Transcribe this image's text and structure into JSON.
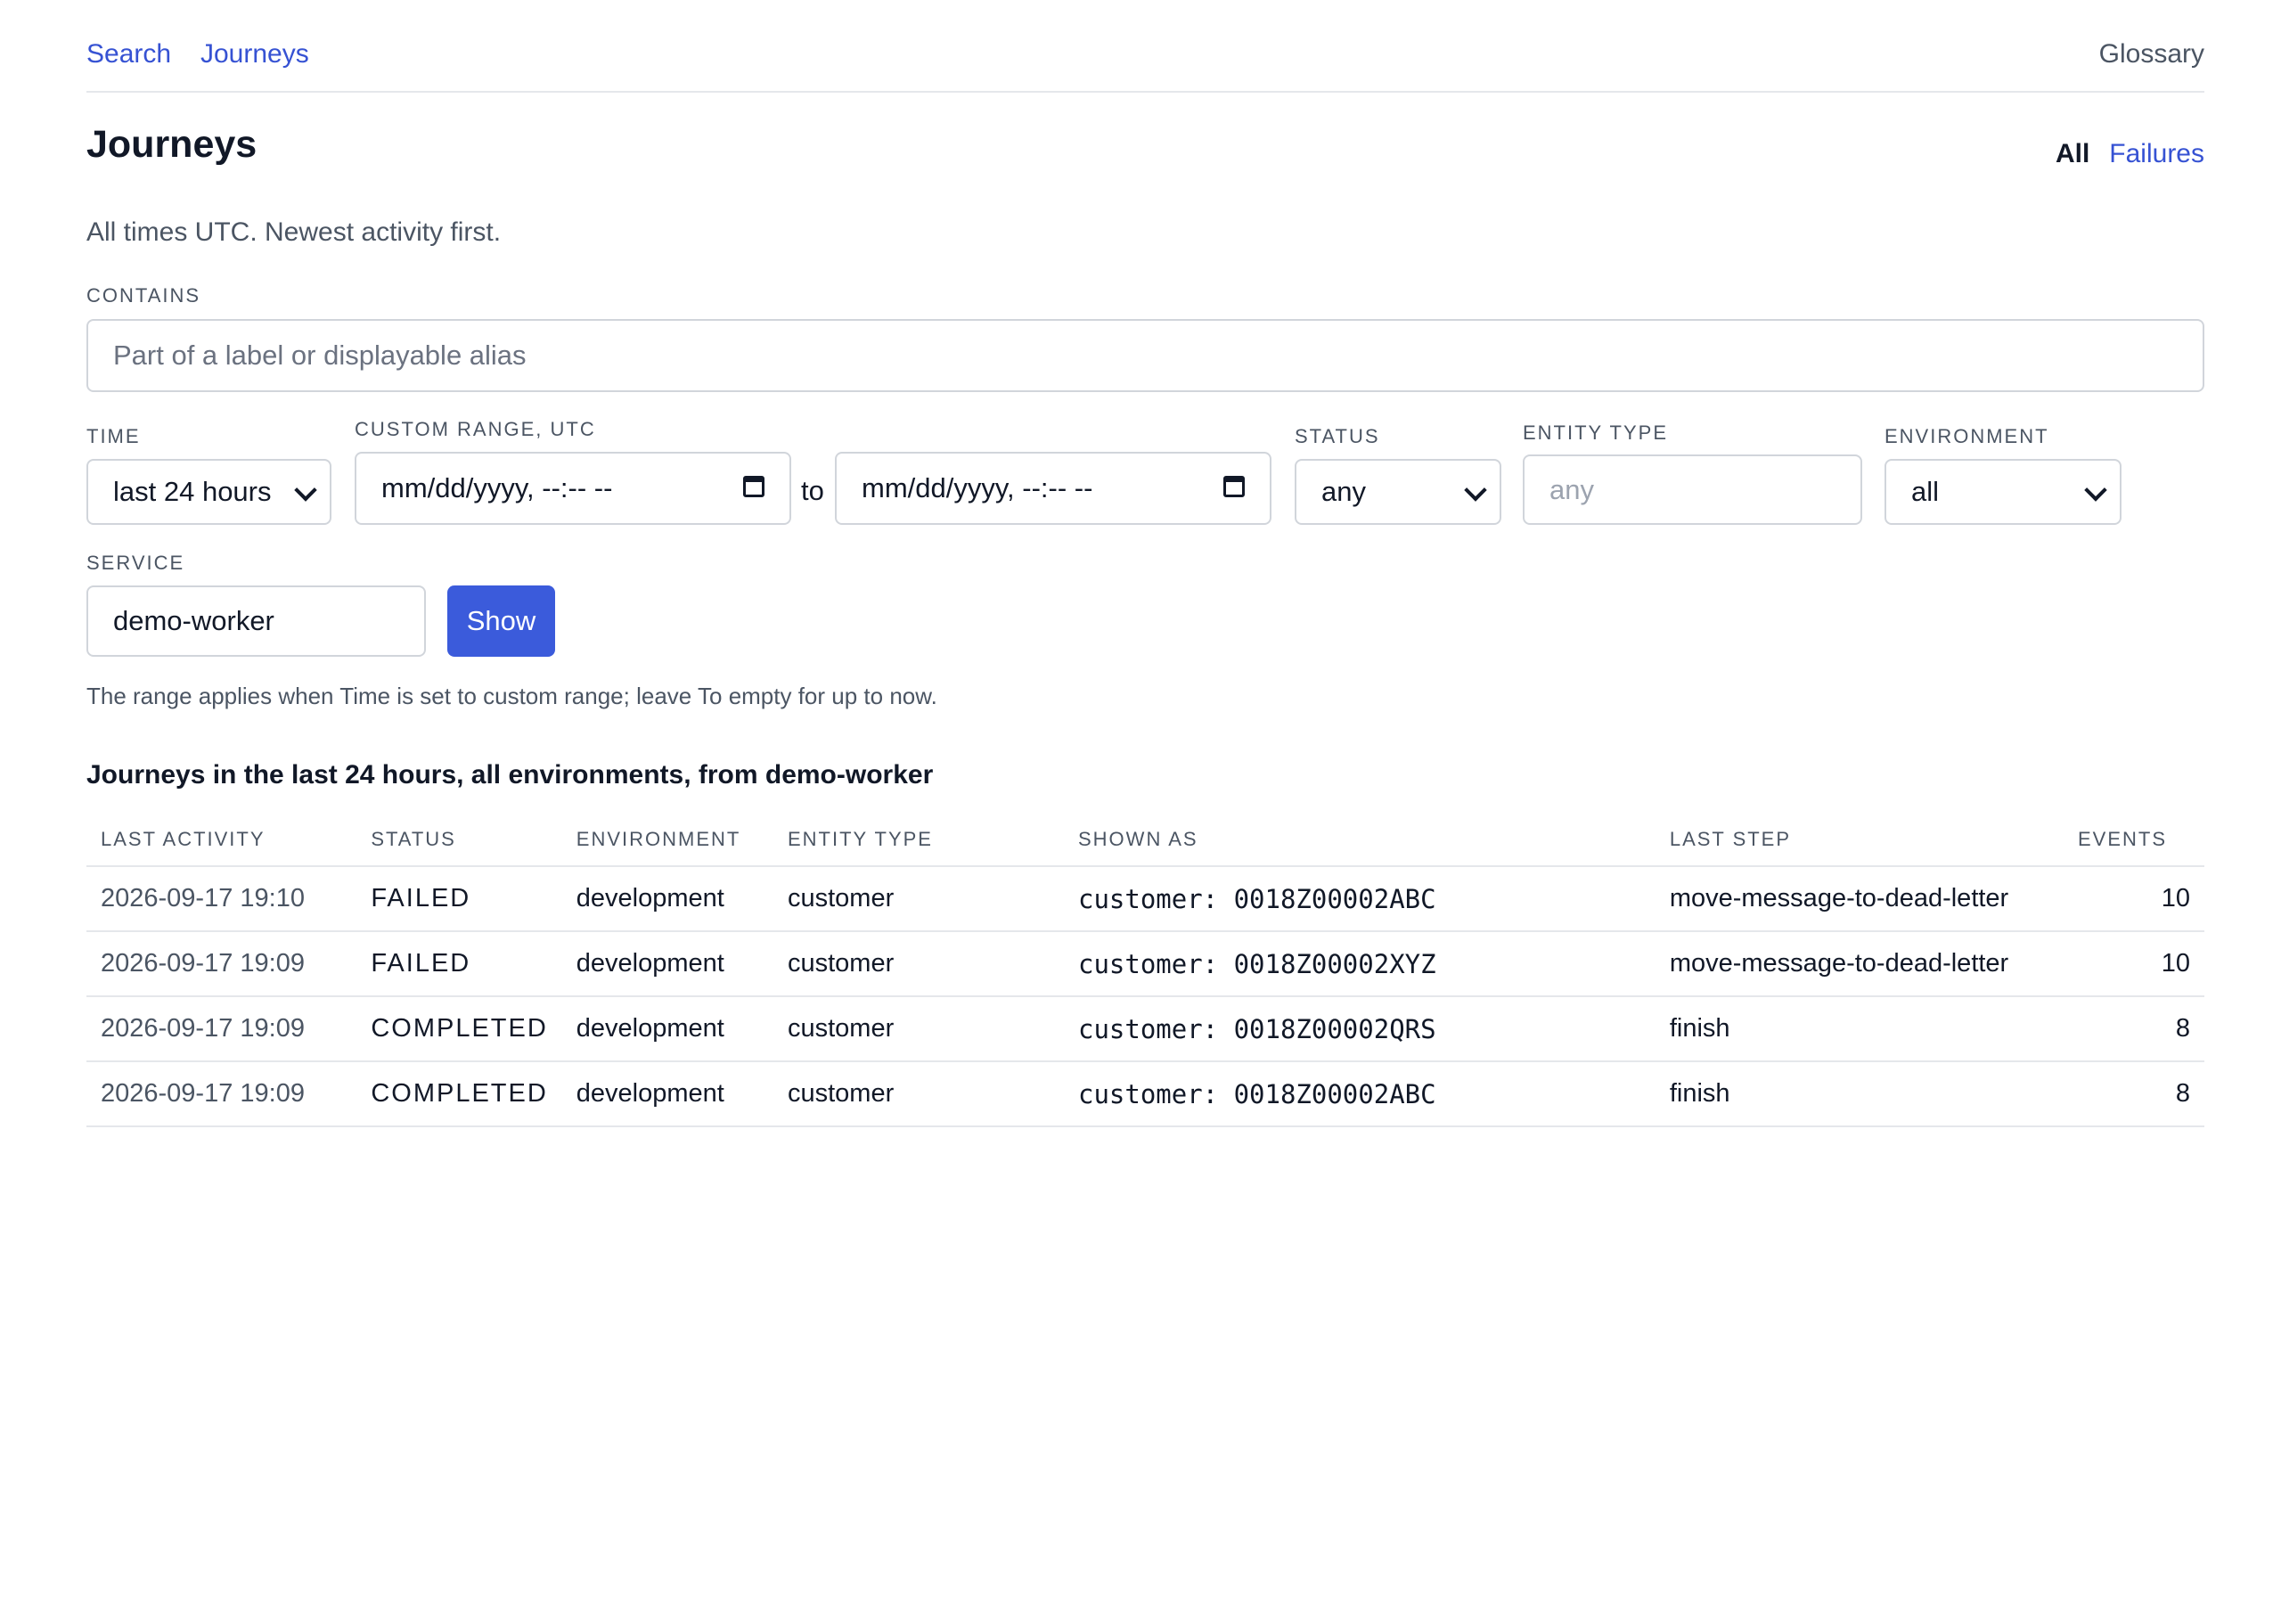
{
  "nav": {
    "search": "Search",
    "journeys": "Journeys",
    "glossary": "Glossary"
  },
  "page": {
    "title": "Journeys",
    "subtitle": "All times UTC. Newest activity first.",
    "view_tabs": {
      "all": "All",
      "failures": "Failures"
    }
  },
  "filters": {
    "contains_label": "CONTAINS",
    "contains_placeholder": "Part of a label or displayable alias",
    "time_label": "TIME",
    "time_value": "last 24 hours",
    "range_label": "CUSTOM RANGE, UTC",
    "range_from_placeholder": "mm/dd/yyyy, --:-- --",
    "range_to_text": "to",
    "range_to_placeholder": "mm/dd/yyyy, --:-- --",
    "status_label": "STATUS",
    "status_value": "any",
    "entity_type_label": "ENTITY TYPE",
    "entity_type_placeholder": "any",
    "environment_label": "ENVIRONMENT",
    "environment_value": "all",
    "service_label": "SERVICE",
    "service_value": "demo-worker",
    "show_button": "Show",
    "hint": "The range applies when Time is set to custom range; leave To empty for up to now."
  },
  "table": {
    "title": "Journeys in the last 24 hours, all environments, from demo-worker",
    "columns": [
      "LAST ACTIVITY",
      "STATUS",
      "ENVIRONMENT",
      "ENTITY TYPE",
      "SHOWN AS",
      "LAST STEP",
      "EVENTS"
    ],
    "rows": [
      {
        "last_activity": "2026-09-17 19:10",
        "status": "FAILED",
        "environment": "development",
        "entity_type": "customer",
        "shown_as": "customer: 0018Z00002ABC",
        "last_step": "move-message-to-dead-letter",
        "events": "10"
      },
      {
        "last_activity": "2026-09-17 19:09",
        "status": "FAILED",
        "environment": "development",
        "entity_type": "customer",
        "shown_as": "customer: 0018Z00002XYZ",
        "last_step": "move-message-to-dead-letter",
        "events": "10"
      },
      {
        "last_activity": "2026-09-17 19:09",
        "status": "COMPLETED",
        "environment": "development",
        "entity_type": "customer",
        "shown_as": "customer: 0018Z00002QRS",
        "last_step": "finish",
        "events": "8"
      },
      {
        "last_activity": "2026-09-17 19:09",
        "status": "COMPLETED",
        "environment": "development",
        "entity_type": "customer",
        "shown_as": "customer: 0018Z00002ABC",
        "last_step": "finish",
        "events": "8"
      }
    ]
  }
}
